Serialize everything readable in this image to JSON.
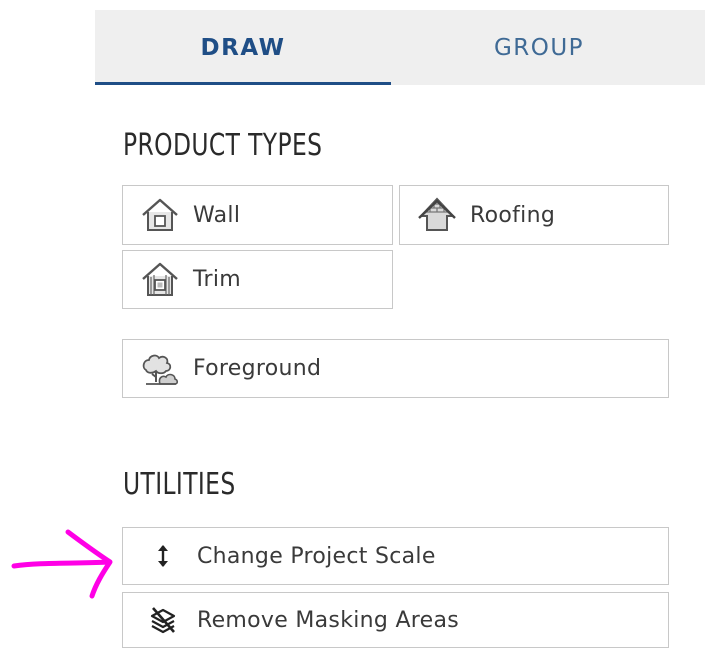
{
  "tabs": [
    {
      "label": "DRAW",
      "active": true
    },
    {
      "label": "GROUP",
      "active": false
    }
  ],
  "product_types": {
    "title": "PRODUCT TYPES",
    "items": [
      {
        "label": "Wall",
        "icon": "house-wall-icon"
      },
      {
        "label": "Roofing",
        "icon": "roof-icon"
      },
      {
        "label": "Trim",
        "icon": "house-trim-icon"
      },
      {
        "label": "Foreground",
        "icon": "tree-bush-icon"
      }
    ]
  },
  "utilities": {
    "title": "UTILITIES",
    "items": [
      {
        "label": "Change Project Scale",
        "icon": "vertical-arrows-icon"
      },
      {
        "label": "Remove Masking Areas",
        "icon": "layers-slash-icon"
      }
    ]
  },
  "colors": {
    "accent": "#1f4e86",
    "tab_bg": "#efefef",
    "border": "#c8c8c8",
    "annotation": "#ff00e6"
  }
}
